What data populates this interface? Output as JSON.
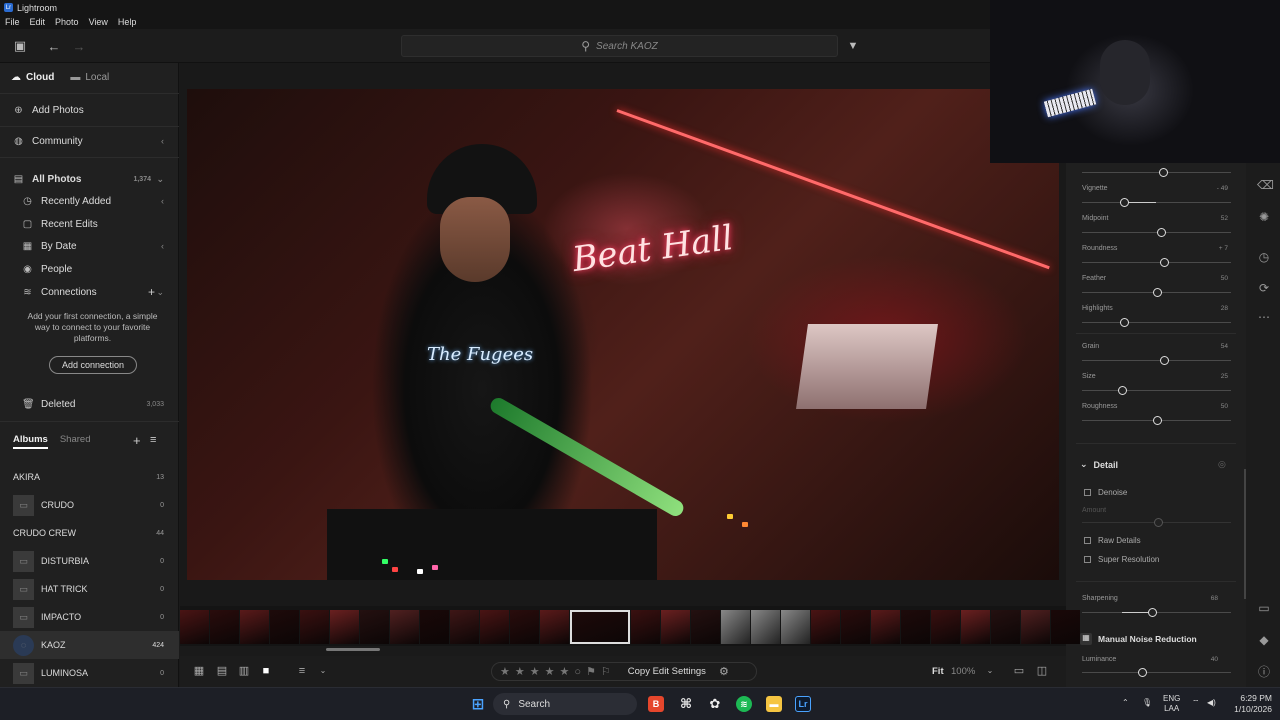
{
  "window": {
    "title": "Lightroom"
  },
  "menu": [
    "File",
    "Edit",
    "Photo",
    "View",
    "Help"
  ],
  "search": {
    "placeholder": "Search KAOZ"
  },
  "left_panel": {
    "tabs": [
      "Cloud",
      "Local"
    ],
    "add_photos": "Add Photos",
    "community": "Community",
    "all_photos": {
      "label": "All Photos",
      "count": "1,374"
    },
    "nav": [
      "Recently Added",
      "Recent Edits",
      "By Date",
      "People"
    ],
    "connections": "Connections",
    "connection_hint": "Add your first connection, a simple way to connect to your favorite platforms.",
    "add_connection": "Add connection",
    "deleted": {
      "label": "Deleted",
      "count": "3,033"
    },
    "album_tabs": [
      "Albums",
      "Shared"
    ],
    "albums": [
      {
        "name": "AKIRA",
        "count": "13"
      },
      {
        "name": "CRUDO",
        "count": "0"
      },
      {
        "name": "CRUDO CREW",
        "count": "44"
      },
      {
        "name": "DISTURBIA",
        "count": "0"
      },
      {
        "name": "HAT TRICK",
        "count": "0"
      },
      {
        "name": "IMPACTO",
        "count": "0"
      },
      {
        "name": "KAOZ",
        "count": "424"
      },
      {
        "name": "LUMINOSA",
        "count": "0"
      }
    ]
  },
  "photo": {
    "sign_text": "Beat Hall",
    "shirt_text": "The Fugees"
  },
  "right_panel": {
    "effects": [
      {
        "label": "Vignette",
        "value": "- 49",
        "pos": 0.28
      },
      {
        "label": "Midpoint",
        "value": "52",
        "pos": 0.53
      },
      {
        "label": "Roundness",
        "value": "+ 7",
        "pos": 0.55
      },
      {
        "label": "Feather",
        "value": "50",
        "pos": 0.5
      },
      {
        "label": "Highlights",
        "value": "28",
        "pos": 0.28
      }
    ],
    "grain": [
      {
        "label": "Grain",
        "value": "54",
        "pos": 0.55
      },
      {
        "label": "Size",
        "value": "25",
        "pos": 0.27
      },
      {
        "label": "Roughness",
        "value": "50",
        "pos": 0.5
      }
    ],
    "detail": {
      "title": "Detail",
      "denoise": "Denoise",
      "amount": "Amount",
      "raw_details": "Raw Details",
      "super_resolution": "Super Resolution",
      "sharpening": {
        "label": "Sharpening",
        "value": "68",
        "pos": 0.47
      },
      "manual_noise": "Manual Noise Reduction",
      "luminance": {
        "label": "Luminance",
        "value": "40",
        "pos": 0.4
      }
    }
  },
  "bottom_bar": {
    "copy_edit": "Copy Edit Settings",
    "fit": "Fit",
    "zoom": "100%"
  },
  "taskbar": {
    "search": "Search",
    "lang_top": "ENG",
    "lang_bottom": "LAA",
    "time": "6:29 PM",
    "date": "1/10/2026"
  }
}
